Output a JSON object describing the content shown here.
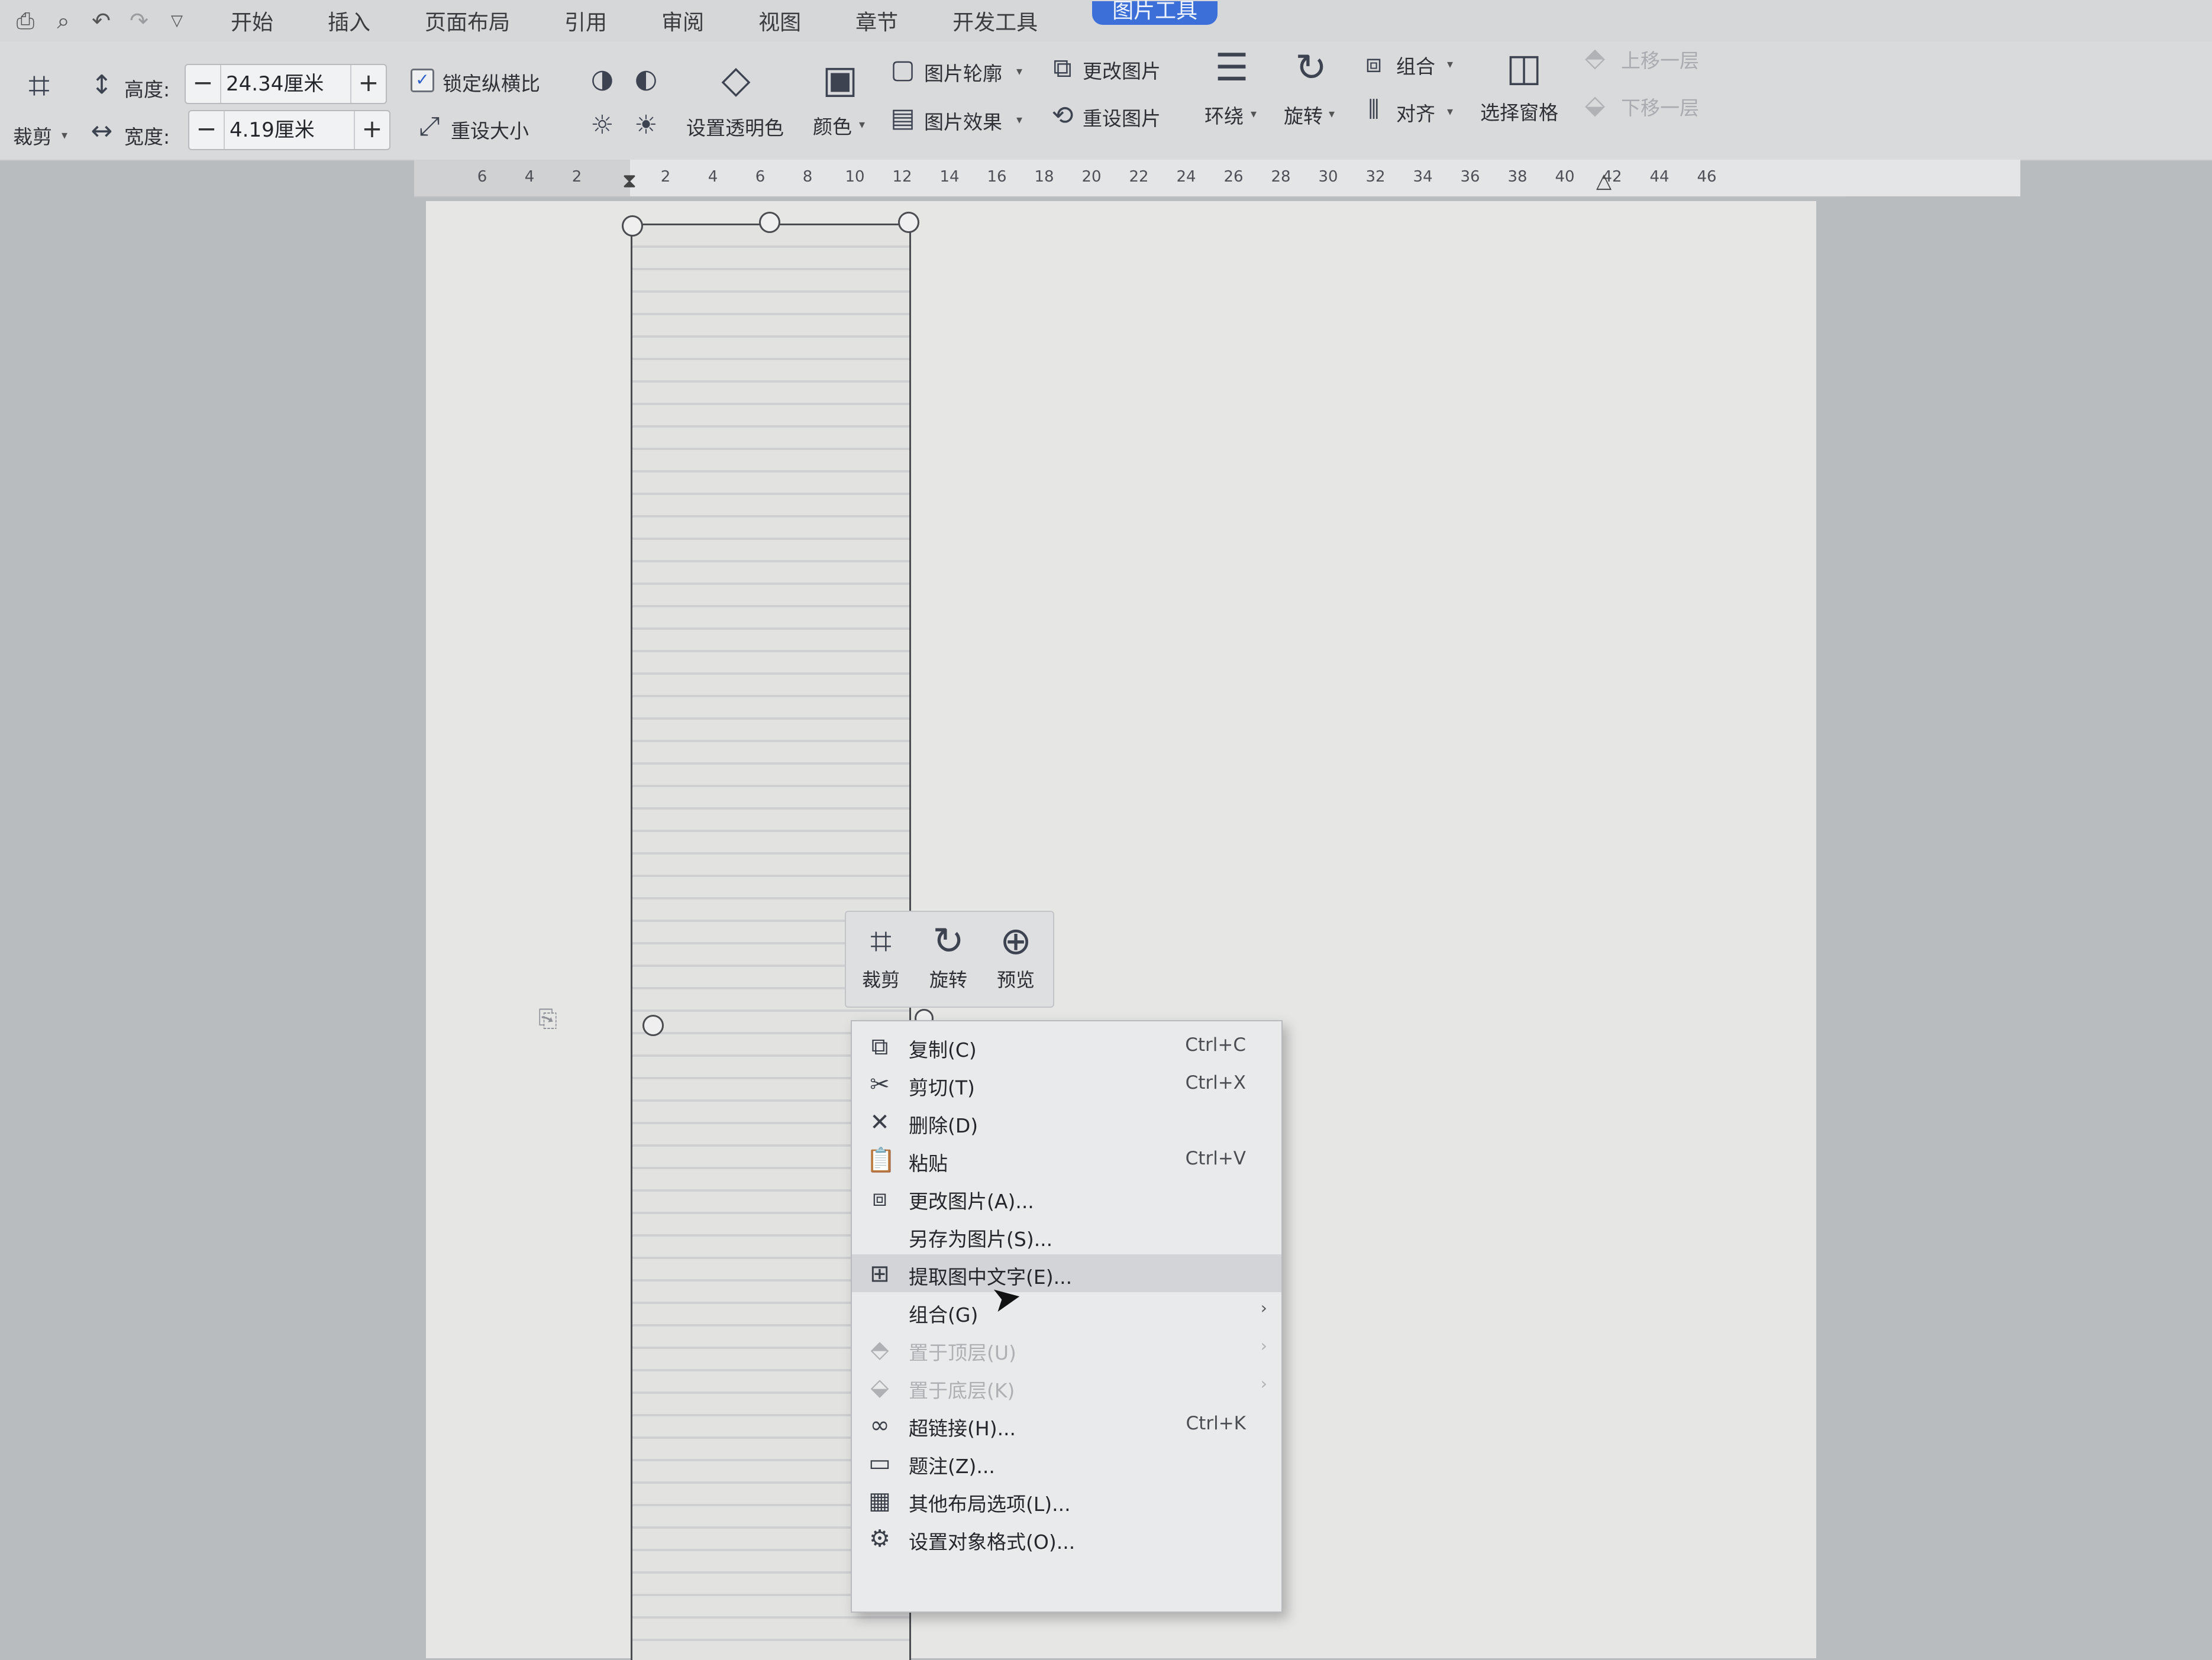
{
  "menubar": {
    "tabs": [
      {
        "label": "开始"
      },
      {
        "label": "插入"
      },
      {
        "label": "页面布局"
      },
      {
        "label": "引用"
      },
      {
        "label": "审阅"
      },
      {
        "label": "视图"
      },
      {
        "label": "章节"
      },
      {
        "label": "开发工具"
      },
      {
        "label": "图片工具"
      }
    ],
    "active_tab": "图片工具",
    "accent_color": "#3c6fd8"
  },
  "ribbon": {
    "crop_label": "裁剪",
    "height_label": "高度:",
    "height_value": "24.34厘米",
    "width_label": "宽度:",
    "width_value": "4.19厘米",
    "minus": "−",
    "plus": "+",
    "lock_ratio_label": "锁定纵横比",
    "lock_ratio_checked": true,
    "checkmark": "✓",
    "reset_size_label": "重设大小",
    "transparent_label": "设置透明色",
    "color_label": "颜色",
    "outline_label": "图片轮廓",
    "effect_label": "图片效果",
    "change_picture_label": "更改图片",
    "reset_picture_label": "重设图片",
    "wrap_label": "环绕",
    "rotate_label": "旋转",
    "group_label": "组合",
    "align_label": "对齐",
    "selection_pane_label": "选择窗格",
    "bring_forward_label": "上移一层",
    "send_backward_label": "下移一层"
  },
  "ruler": {
    "ticks": [
      "6",
      "4",
      "2",
      "2",
      "4",
      "6",
      "8",
      "10",
      "12",
      "14",
      "16",
      "18",
      "20",
      "22",
      "24",
      "26",
      "28",
      "30",
      "32",
      "34",
      "36",
      "38",
      "40",
      "42",
      "44",
      "46"
    ]
  },
  "mini_toolbar": {
    "crop_label": "裁剪",
    "rotate_label": "旋转",
    "preview_label": "预览"
  },
  "context_menu": {
    "items": [
      {
        "label": "复制(C)",
        "shortcut": "Ctrl+C",
        "icon": "copy-icon",
        "enabled": true
      },
      {
        "label": "剪切(T)",
        "shortcut": "Ctrl+X",
        "icon": "cut-icon",
        "enabled": true
      },
      {
        "label": "删除(D)",
        "shortcut": "",
        "icon": "delete-icon",
        "enabled": true
      },
      {
        "label": "粘贴",
        "shortcut": "Ctrl+V",
        "icon": "paste-icon",
        "enabled": true
      },
      {
        "label": "更改图片(A)...",
        "shortcut": "",
        "icon": "change-picture-icon",
        "enabled": true
      },
      {
        "label": "另存为图片(S)...",
        "shortcut": "",
        "icon": "",
        "enabled": true
      },
      {
        "label": "提取图中文字(E)...",
        "shortcut": "",
        "icon": "extract-text-icon",
        "enabled": true,
        "hover": true
      },
      {
        "label": "组合(G)",
        "shortcut": "",
        "icon": "",
        "enabled": true,
        "submenu": true
      },
      {
        "label": "置于顶层(U)",
        "shortcut": "",
        "icon": "bring-to-front-icon",
        "enabled": false,
        "submenu": true
      },
      {
        "label": "置于底层(K)",
        "shortcut": "",
        "icon": "send-to-back-icon",
        "enabled": false,
        "submenu": true
      },
      {
        "label": "超链接(H)...",
        "shortcut": "Ctrl+K",
        "icon": "hyperlink-icon",
        "enabled": true
      },
      {
        "label": "题注(Z)...",
        "shortcut": "",
        "icon": "caption-icon",
        "enabled": true
      },
      {
        "label": "其他布局选项(L)...",
        "shortcut": "",
        "icon": "layout-options-icon",
        "enabled": true
      },
      {
        "label": "设置对象格式(O)...",
        "shortcut": "",
        "icon": "format-object-icon",
        "enabled": true
      }
    ]
  }
}
